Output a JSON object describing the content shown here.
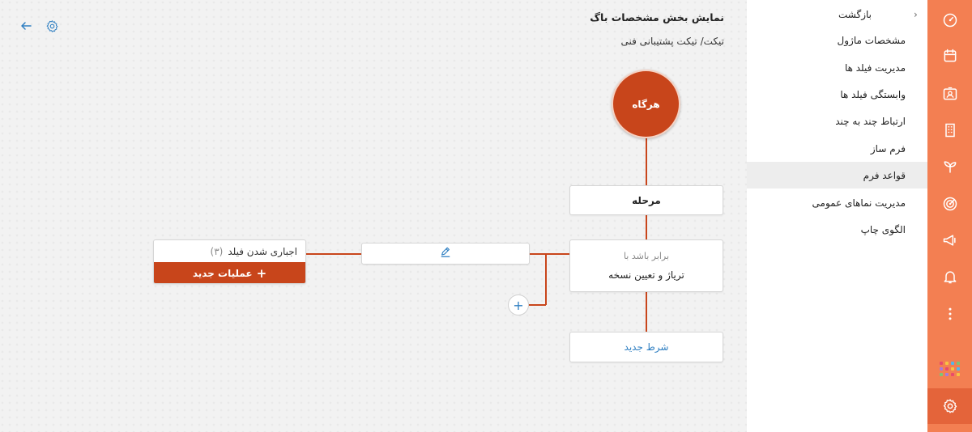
{
  "header": {
    "title": "نمایش بخش مشخصات باگ",
    "breadcrumb": "تیکت/ تیکت پشتیبانی فنی"
  },
  "toolbar": {
    "back_icon": "arrow-left-icon",
    "settings_icon": "gear-icon"
  },
  "flow": {
    "trigger_label": "هرگاه",
    "stage_label": "مرحله",
    "condition": {
      "operator_label": "برابر باشد با",
      "value_label": "تریاژ و تعیین نسخه"
    },
    "new_condition_label": "شرط جدید",
    "add_branch_symbol": "+",
    "action": {
      "title": "اجباری شدن فیلد",
      "count": "(۳)",
      "new_action_label": "عملیات جدید",
      "plus_symbol": "+"
    }
  },
  "menu": {
    "back_label": "بازگشت",
    "back_chevron": "‹",
    "items": [
      {
        "label": "مشخصات ماژول"
      },
      {
        "label": "مدیریت فیلد ها"
      },
      {
        "label": "وابستگی فیلد ها"
      },
      {
        "label": "ارتباط چند به چند"
      },
      {
        "label": "فرم ساز"
      },
      {
        "label": "قواعد فرم"
      },
      {
        "label": "مدیریت نماهای عمومی"
      },
      {
        "label": "الگوی چاپ"
      }
    ],
    "active_item": "قواعد فرم"
  },
  "rail": {
    "icons": [
      "dashboard-icon",
      "calendar-icon",
      "contact-card-icon",
      "building-icon",
      "sprout-icon",
      "target-icon",
      "megaphone-icon",
      "bell-icon",
      "more-vertical-icon",
      "apps-grid-icon",
      "gear-icon"
    ],
    "active_icon": "gear-icon"
  },
  "colors": {
    "accent": "#c8451b",
    "rail": "#f37f52",
    "rail_active": "#e4643a",
    "link": "#2f7fc2"
  }
}
